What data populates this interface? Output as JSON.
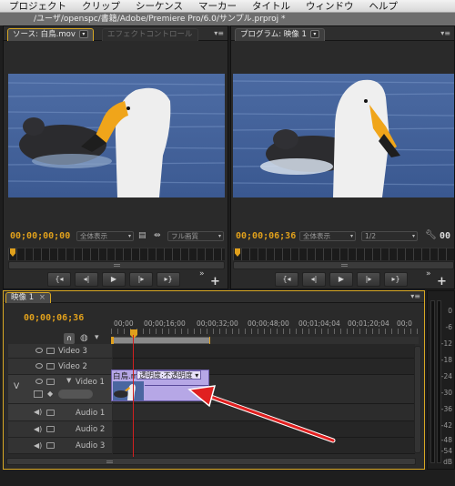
{
  "menubar": {
    "items": [
      "プロジェクト",
      "クリップ",
      "シーケンス",
      "マーカー",
      "タイトル",
      "ウィンドウ",
      "ヘルプ"
    ]
  },
  "window": {
    "title": "/ユーザ/openspc/書籍/Adobe/Premiere Pro/6.0/サンプル.prproj *"
  },
  "source_monitor": {
    "tab_label": "ソース: 白鳥.mov",
    "tab2_label": "エフェクトコントロール",
    "timecode": "00;00;00;00",
    "zoom_select": "全体表示",
    "quality_select": "フル画質"
  },
  "program_monitor": {
    "tab_label": "プログラム: 映像 1",
    "timecode": "00;00;06;36",
    "zoom_select": "全体表示",
    "resolution_select": "1/2",
    "duration_fragment": "00"
  },
  "timeline": {
    "tab_label": "映像 1",
    "timecode": "00;00;06;36",
    "ruler_labels": [
      "00;00",
      "00;00;16;00",
      "00;00;32;00",
      "00;00;48;00",
      "00;01;04;04",
      "00;01;20;04",
      "00;0"
    ],
    "tracks": [
      {
        "name": "Video 3",
        "kind": "video"
      },
      {
        "name": "Video 2",
        "kind": "video"
      },
      {
        "name": "Video 1",
        "kind": "video"
      },
      {
        "name": "Audio 1",
        "kind": "audio"
      },
      {
        "name": "Audio 2",
        "kind": "audio"
      },
      {
        "name": "Audio 3",
        "kind": "audio"
      }
    ],
    "target_video_label": "V",
    "clip": {
      "title": "白鳥.mov",
      "opacity_label": "透明度:不透明度"
    }
  },
  "meter": {
    "labels": [
      "0",
      "-6",
      "-12",
      "-18",
      "-24",
      "-30",
      "-36",
      "-42",
      "-48",
      "-54",
      "dB"
    ]
  },
  "colors": {
    "accent_timecode": "#e0a01c",
    "clip_fill": "#b6a7e6",
    "annotation_arrow": "#e02020",
    "focus_border": "#d8a824"
  },
  "icons": {
    "transport": [
      "step-back-marker-icon",
      "step-back-frame-icon",
      "play-icon",
      "step-forward-frame-icon",
      "step-forward-marker-icon"
    ]
  }
}
